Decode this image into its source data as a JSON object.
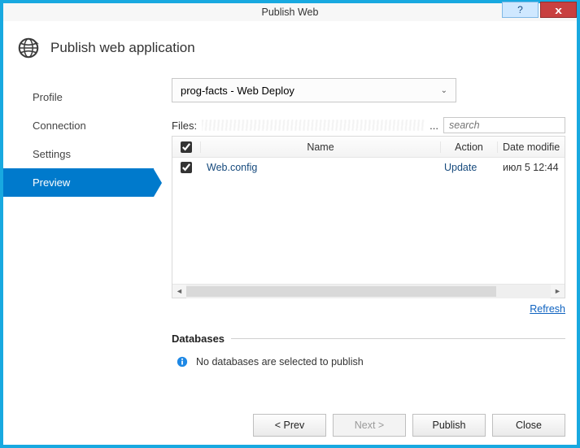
{
  "titlebar": {
    "left": "",
    "title": "Publish Web",
    "help": "?",
    "close": "x"
  },
  "header": {
    "title": "Publish web application"
  },
  "nav": {
    "items": [
      {
        "label": "Profile"
      },
      {
        "label": "Connection"
      },
      {
        "label": "Settings"
      },
      {
        "label": "Preview",
        "active": true
      }
    ]
  },
  "dropdown": {
    "value": "prog-facts - Web Deploy"
  },
  "files_label": "Files:",
  "files_ellipsis": "...",
  "search": {
    "placeholder": "search"
  },
  "grid": {
    "columns": {
      "name": "Name",
      "action": "Action",
      "date": "Date modifie"
    },
    "rows": [
      {
        "checked": true,
        "name": "Web.config",
        "action": "Update",
        "date": "июл 5 12:44"
      }
    ]
  },
  "refresh": "Refresh",
  "databases": {
    "title": "Databases",
    "message": "No databases are selected to publish"
  },
  "buttons": {
    "prev": "< Prev",
    "next": "Next >",
    "publish": "Publish",
    "close": "Close"
  }
}
